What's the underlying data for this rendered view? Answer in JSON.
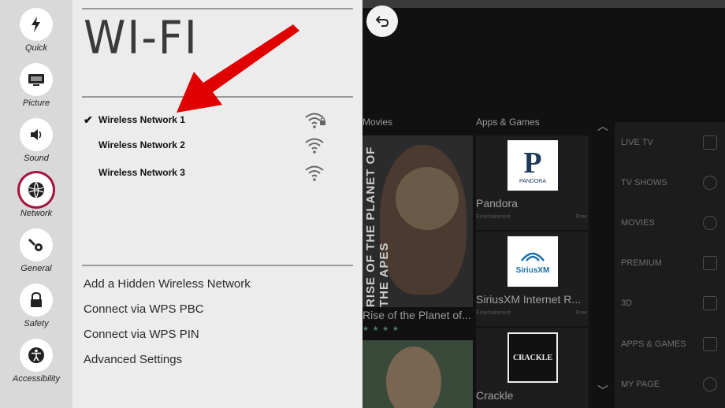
{
  "rail": {
    "items": [
      {
        "label": "Quick",
        "icon": "lightning-icon",
        "active": false
      },
      {
        "label": "Picture",
        "icon": "picture-icon",
        "active": false
      },
      {
        "label": "Sound",
        "icon": "sound-icon",
        "active": false
      },
      {
        "label": "Network",
        "icon": "globe-icon",
        "active": true
      },
      {
        "label": "General",
        "icon": "wrench-gear-icon",
        "active": false
      },
      {
        "label": "Safety",
        "icon": "lock-icon",
        "active": false
      },
      {
        "label": "Accessibility",
        "icon": "accessibility-icon",
        "active": false
      }
    ],
    "active_color": "#a5143f"
  },
  "panel": {
    "title": "WI-FI",
    "networks": [
      {
        "name": "Wireless Network 1",
        "connected": true,
        "secured": true
      },
      {
        "name": "Wireless Network 2",
        "connected": false,
        "secured": false
      },
      {
        "name": "Wireless Network 3",
        "connected": false,
        "secured": false
      }
    ],
    "check_glyph": "✔",
    "options": [
      "Add a Hidden Wireless Network",
      "Connect via WPS PBC",
      "Connect via WPS PIN",
      "Advanced Settings"
    ]
  },
  "annotation": {
    "color": "#e00000",
    "points_to": "Wireless Network 1"
  },
  "content": {
    "back_icon": "back-arrow-icon",
    "sections": {
      "movies": "Movies",
      "apps": "Apps & Games"
    },
    "movies": [
      {
        "poster_text": "RISE OF THE PLANET OF THE APES",
        "title": "Rise of the Planet of...",
        "stars": "★ ★ ★ ★"
      },
      {
        "poster_text": "",
        "title": "",
        "stars": ""
      }
    ],
    "apps": [
      {
        "name": "Pandora",
        "logo": "P",
        "logo_sub": "PANDORA",
        "category": "Entertainment",
        "price": "Free"
      },
      {
        "name": "SiriusXM Internet R...",
        "logo": "SiriusXM",
        "logo_sub": "",
        "category": "Entertainment",
        "price": "Free"
      },
      {
        "name": "Crackle",
        "logo": "CRACKLE",
        "logo_sub": "",
        "category": "",
        "price": ""
      }
    ],
    "categories": [
      "LIVE TV",
      "TV SHOWS",
      "MOVIES",
      "PREMIUM",
      "3D",
      "APPS & GAMES",
      "MY PAGE"
    ]
  }
}
